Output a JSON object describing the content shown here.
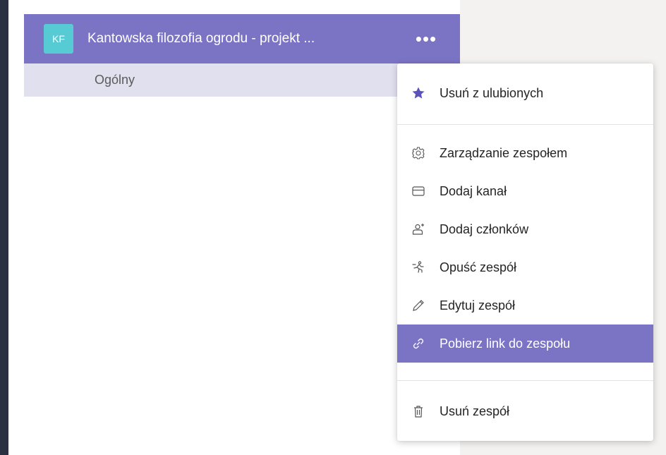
{
  "team": {
    "initials": "KF",
    "name": "Kantowska filozofia ogrodu - projekt ...",
    "more_label": "•••",
    "channel": "Ogólny"
  },
  "menu": {
    "items": [
      {
        "label": "Usuń z ulubionych",
        "icon": "star-icon"
      },
      {
        "label": "Zarządzanie zespołem",
        "icon": "gear-icon"
      },
      {
        "label": "Dodaj kanał",
        "icon": "channel-icon"
      },
      {
        "label": "Dodaj członków",
        "icon": "add-person-icon"
      },
      {
        "label": "Opuść zespół",
        "icon": "leave-icon"
      },
      {
        "label": "Edytuj zespół",
        "icon": "pencil-icon"
      },
      {
        "label": "Pobierz link do zespołu",
        "icon": "link-icon"
      },
      {
        "label": "Usuń zespół",
        "icon": "trash-icon"
      }
    ]
  },
  "colors": {
    "accent": "#7b74c5",
    "rail": "#2b3043",
    "avatar": "#56cbd4",
    "channel_row": "#e1e0ef"
  }
}
